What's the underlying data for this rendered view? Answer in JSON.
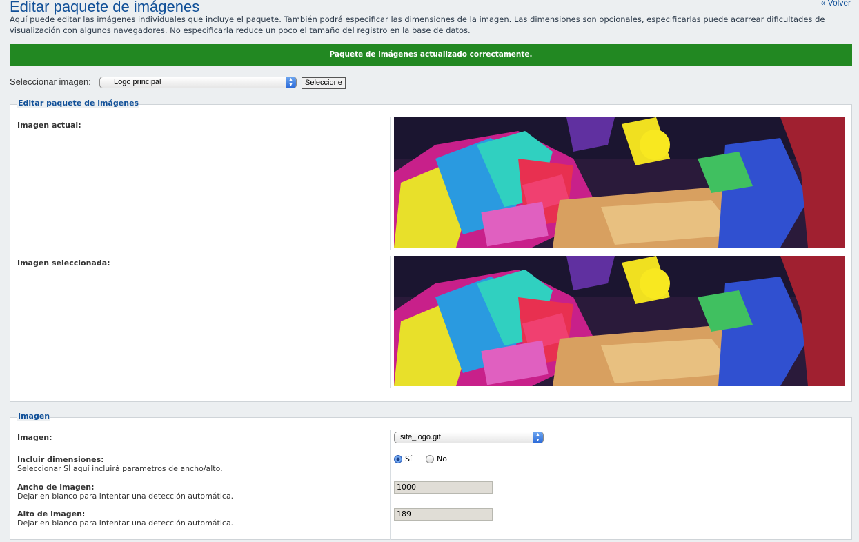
{
  "header": {
    "title": "Editar paquete de imágenes",
    "back_label": "« Volver",
    "intro": "Aquí puede editar las imágenes individuales que incluye el paquete. También podrá especificar las dimensiones de la imagen. Las dimensiones son opcionales, especificarlas puede acarrear dificultades de visualización con algunos navegadores. No especificarla reduce un poco el tamaño del registro en la base de datos."
  },
  "success_message": "Paquete de imágenes actualizado correctamente.",
  "selector": {
    "label": "Seleccionar imagen:",
    "selected": "Logo principal",
    "button_label": "Seleccione"
  },
  "preview_panel": {
    "legend": "Editar paquete de imágenes",
    "current_label": "Imagen actual:",
    "selected_label": "Imagen seleccionada:"
  },
  "image_panel": {
    "legend": "Imagen",
    "image_label": "Imagen:",
    "image_value": "site_logo.gif",
    "dims_label": "Incluir dimensiones:",
    "dims_desc": "Seleccionar SÍ aquí incluirá parametros de ancho/alto.",
    "yes_label": "Sí",
    "no_label": "No",
    "dims_selected": "yes",
    "width_label": "Ancho de imagen:",
    "width_desc": "Dejar en blanco para intentar una detección automática.",
    "width_value": "1000",
    "height_label": "Alto de imagen:",
    "height_desc": "Dejar en blanco para intentar una detección automática.",
    "height_value": "189"
  },
  "colors": {
    "accent": "#115098",
    "success": "#228822",
    "background": "#eceff1"
  },
  "icons": [
    "select-arrows-icon",
    "radio-icon"
  ]
}
